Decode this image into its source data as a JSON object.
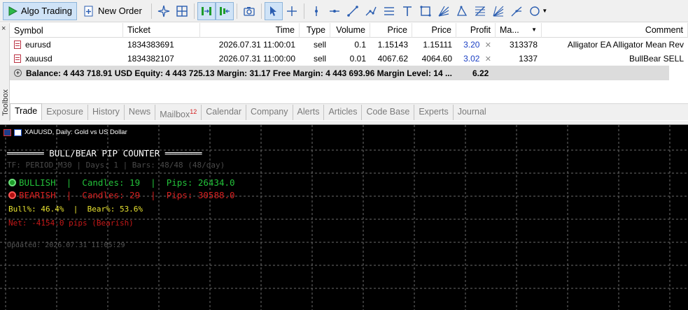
{
  "toolbar": {
    "algo_trading_label": "Algo Trading",
    "new_order_label": "New Order"
  },
  "toolbox": {
    "close_glyph": "×",
    "side_label": "Toolbox"
  },
  "table": {
    "headers": {
      "symbol": "Symbol",
      "ticket": "Ticket",
      "time": "Time",
      "type": "Type",
      "volume": "Volume",
      "price_open": "Price",
      "price_current": "Price",
      "profit": "Profit",
      "magic": "Ma...",
      "comment": "Comment"
    },
    "rows": [
      {
        "symbol": "eurusd",
        "ticket": "1834383691",
        "time": "2026.07.31 11:00:01",
        "type": "sell",
        "volume": "0.1",
        "price_open": "1.15143",
        "price_current": "1.15111",
        "profit": "3.20",
        "magic": "313378",
        "comment": "Alligator EA Alligator Mean Rev"
      },
      {
        "symbol": "xauusd",
        "ticket": "1834382107",
        "time": "2026.07.31 11:00:00",
        "type": "sell",
        "volume": "0.01",
        "price_open": "4067.62",
        "price_current": "4064.60",
        "profit": "3.02",
        "magic": "1337",
        "comment": "BullBear SELL"
      }
    ],
    "balance_line": "Balance: 4 443 718.91 USD  Equity: 4 443 725.13  Margin: 31.17  Free Margin: 4 443 693.96  Margin Level: 14 ...",
    "total_profit": "6.22"
  },
  "tabs": [
    {
      "label": "Trade",
      "active": true
    },
    {
      "label": "Exposure"
    },
    {
      "label": "History"
    },
    {
      "label": "News"
    },
    {
      "label": "Mailbox",
      "badge": "12"
    },
    {
      "label": "Calendar"
    },
    {
      "label": "Company"
    },
    {
      "label": "Alerts"
    },
    {
      "label": "Articles"
    },
    {
      "label": "Code Base"
    },
    {
      "label": "Experts"
    },
    {
      "label": "Journal"
    }
  ],
  "chart": {
    "title": "XAUUSD, Daily:  Gold vs US Dollar",
    "background": "#000000",
    "indicator": {
      "title": "═══════ BULL/BEAR PIP COUNTER ═══════",
      "tf_line": "TF: PERIOD_M30 | Days: 1 | Bars: 48/48 (48/day)",
      "bull_line": "BULLISH  |  Candles: 19  |  Pips: 26434.0",
      "bear_line": "BEARISH  |  Candles: 29  |  Pips: 30588.0",
      "pct_line": "Bull%: 46.4%  |  Bear%: 53.6%",
      "net_line": "Net: -4154.0 pips (Bearish)",
      "updated_line": "Updated: 2026.07.31 11:05:29",
      "colors": {
        "bull": "#23c23a",
        "bear": "#d62020",
        "pct": "#e8e330",
        "net": "#c41818"
      }
    }
  },
  "icons": [
    "play-icon",
    "new-order-icon",
    "crosshair-star-icon",
    "grid-icon",
    "split-chart-icon",
    "chart-shift-icon",
    "camera-icon",
    "cursor-icon",
    "crosshair-icon",
    "vertical-line-icon",
    "horizontal-line-icon",
    "trendline-icon",
    "angle-line-icon",
    "channel-icon",
    "text-icon",
    "rectangle-icon",
    "fan-icon",
    "triangle-icon",
    "fibonacci-icon",
    "gann-icon",
    "pitchfork-icon",
    "shapes-icon"
  ]
}
